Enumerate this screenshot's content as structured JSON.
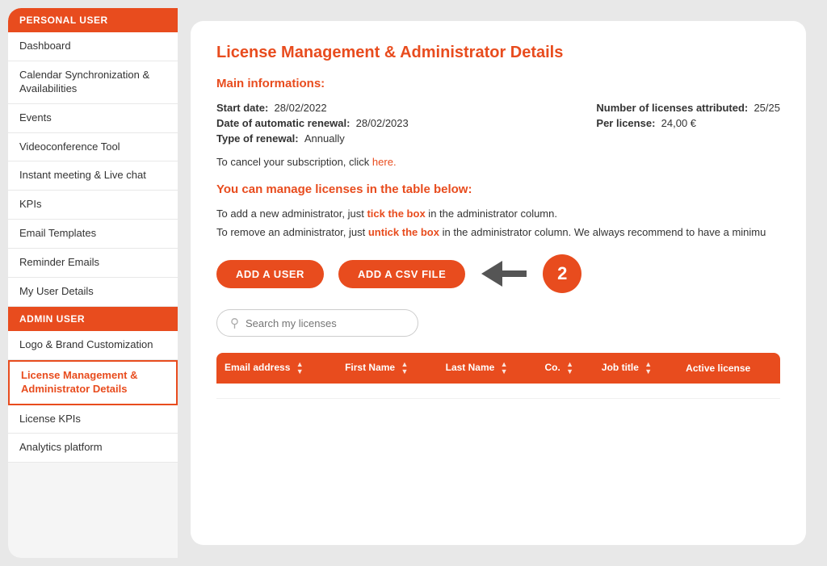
{
  "sidebar": {
    "personal_user_label": "PERSONAL USER",
    "admin_user_label": "ADMIN USER",
    "items_personal": [
      {
        "label": "Dashboard",
        "active": false
      },
      {
        "label": "Calendar Synchronization & Availabilities",
        "active": false
      },
      {
        "label": "Events",
        "active": false
      },
      {
        "label": "Videoconference Tool",
        "active": false
      },
      {
        "label": "Instant meeting & Live chat",
        "active": false
      },
      {
        "label": "KPIs",
        "active": false
      },
      {
        "label": "Email Templates",
        "active": false
      },
      {
        "label": "Reminder Emails",
        "active": false
      },
      {
        "label": "My User Details",
        "active": false
      }
    ],
    "items_admin": [
      {
        "label": "Logo & Brand Customization",
        "active": false
      },
      {
        "label": "License Management & Administrator Details",
        "active": true
      },
      {
        "label": "License KPIs",
        "active": false
      },
      {
        "label": "Analytics platform",
        "active": false
      }
    ]
  },
  "main": {
    "page_title": "License Management & Administrator Details",
    "section_main_info": "Main informations:",
    "start_date_label": "Start date:",
    "start_date_value": "28/02/2022",
    "renewal_date_label": "Date of automatic renewal:",
    "renewal_date_value": "28/02/2023",
    "type_renewal_label": "Type of renewal:",
    "type_renewal_value": "Annually",
    "num_licenses_label": "Number of licenses attributed:",
    "num_licenses_value": "25/25",
    "per_license_label": "Per license:",
    "per_license_value": "24,00 €",
    "cancel_text": "To cancel your subscription, click ",
    "cancel_link": "here.",
    "manage_section_title": "You can manage licenses in the table below:",
    "add_admin_text": "To add a new administrator, just ",
    "add_admin_highlight": "tick the box",
    "add_admin_text2": " in the administrator column.",
    "remove_admin_text": "To remove an administrator, just ",
    "remove_admin_highlight": "untick the box",
    "remove_admin_text2": " in the administrator column. We always recommend to have a minimu",
    "btn_add_user": "ADD A USER",
    "btn_add_csv": "ADD A CSV FILE",
    "badge_number": "2",
    "search_placeholder": "Search my licenses",
    "table_headers": [
      {
        "label": "Email address",
        "sort": true
      },
      {
        "label": "First Name",
        "sort": true
      },
      {
        "label": "Last Name",
        "sort": true
      },
      {
        "label": "Co.",
        "sort": true
      },
      {
        "label": "Job title",
        "sort": true
      },
      {
        "label": "Active license",
        "sort": false
      }
    ]
  }
}
